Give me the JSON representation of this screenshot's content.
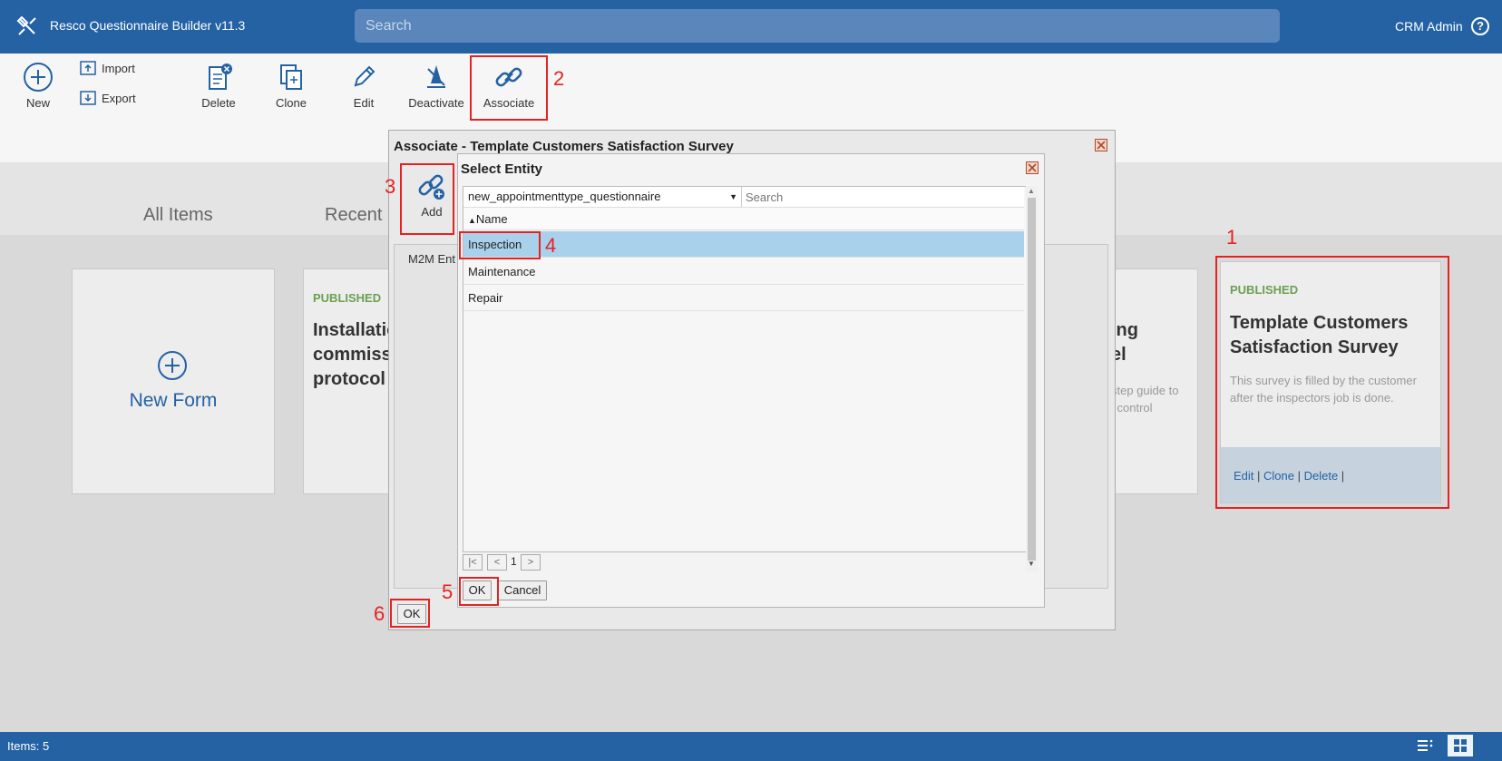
{
  "app": {
    "title": "Resco Questionnaire Builder v11.3",
    "search_placeholder": "Search",
    "user": "CRM Admin"
  },
  "toolbar": {
    "new": "New",
    "import": "Import",
    "export": "Export",
    "delete": "Delete",
    "clone": "Clone",
    "edit": "Edit",
    "deactivate": "Deactivate",
    "associate": "Associate"
  },
  "tabs": {
    "all_items": "All Items",
    "recent": "Recent"
  },
  "cards": {
    "new_form": "New Form",
    "card1": {
      "status": "PUBLISHED",
      "title_lines": [
        "Installatio",
        "commissi",
        "protocol"
      ]
    },
    "card2": {
      "title_lines": [
        "ing",
        "el"
      ],
      "desc_lines": [
        "step guide to",
        "l control"
      ]
    },
    "card3": {
      "status": "PUBLISHED",
      "title_lines": [
        "Template Customers",
        "Satisfaction Survey"
      ],
      "desc_lines": [
        "This survey is filled by the customer",
        "after the inspectors job is done."
      ],
      "links": [
        "Edit",
        "Clone",
        "Delete"
      ]
    }
  },
  "associate_dialog": {
    "title": "Associate - Template Customers Satisfaction Survey",
    "add": "Add",
    "m2m_tab": "M2M Ent",
    "ok": "OK"
  },
  "select_entity": {
    "title": "Select Entity",
    "entity": "new_appointmenttype_questionnaire",
    "search_placeholder": "Search",
    "column_name": "Name",
    "rows": [
      "Inspection",
      "Maintenance",
      "Repair"
    ],
    "selected_row": 0,
    "pager": {
      "first": "|<",
      "prev": "<",
      "page": "1",
      "next": ">"
    },
    "ok": "OK",
    "cancel": "Cancel"
  },
  "callouts": [
    "1",
    "2",
    "3",
    "4",
    "5",
    "6"
  ],
  "status": {
    "items": "Items: 5"
  },
  "colors": {
    "topbar": "#2462a4",
    "selected_row": "#a9d1ec",
    "callout": "#e52222",
    "published": "#6d9f52"
  }
}
